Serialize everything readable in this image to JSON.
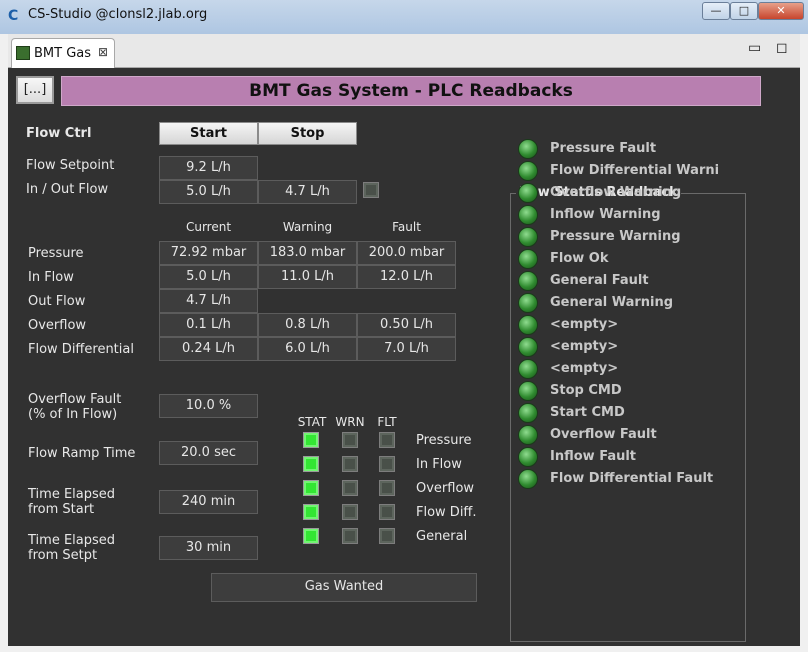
{
  "window": {
    "title": "CS-Studio @clonsl2.jlab.org",
    "min": "—",
    "max": "□",
    "close": "✕"
  },
  "tab": {
    "label": "BMT Gas",
    "close": "⊠"
  },
  "panel": {
    "minimize": "▭",
    "maximize": "◻"
  },
  "header": {
    "menu_button": "[...]",
    "title": "BMT Gas System - PLC Readbacks"
  },
  "flow_ctrl": {
    "label": "Flow Ctrl",
    "start": "Start",
    "stop": "Stop"
  },
  "flow_setpoint": {
    "label": "Flow Setpoint",
    "value": "9.2 L/h"
  },
  "in_out_flow": {
    "label": "In / Out Flow",
    "in_value": "5.0 L/h",
    "out_value": "4.7 L/h"
  },
  "table": {
    "columns": [
      "Current",
      "Warning",
      "Fault"
    ],
    "rows": [
      {
        "label": "Pressure",
        "current": "72.92 mbar",
        "warning": "183.0 mbar",
        "fault": "200.0 mbar"
      },
      {
        "label": "In Flow",
        "current": "5.0 L/h",
        "warning": "11.0 L/h",
        "fault": "12.0 L/h"
      },
      {
        "label": "Out Flow",
        "current": "4.7 L/h",
        "warning": "",
        "fault": ""
      },
      {
        "label": "Overflow",
        "current": "0.1 L/h",
        "warning": "0.8 L/h",
        "fault": "0.50 L/h"
      },
      {
        "label": "Flow Differential",
        "current": "0.24 L/h",
        "warning": "6.0 L/h",
        "fault": "7.0 L/h"
      }
    ]
  },
  "params": [
    {
      "label_line1": "Overflow Fault",
      "label_line2": "(% of In Flow)",
      "value": "10.0 %"
    },
    {
      "label_line1": "Flow Ramp Time",
      "label_line2": "",
      "value": "20.0 sec"
    },
    {
      "label_line1": "Time Elapsed",
      "label_line2": "from Start",
      "value": "240 min"
    },
    {
      "label_line1": "Time Elapsed",
      "label_line2": "from Setpt",
      "value": "30 min"
    }
  ],
  "status_matrix": {
    "headers": [
      "STAT",
      "WRN",
      "FLT"
    ],
    "rows": [
      {
        "label": "Pressure",
        "stat": true,
        "wrn": false,
        "flt": false
      },
      {
        "label": "In Flow",
        "stat": true,
        "wrn": false,
        "flt": false
      },
      {
        "label": "Overflow",
        "stat": true,
        "wrn": false,
        "flt": false
      },
      {
        "label": "Flow Diff.",
        "stat": true,
        "wrn": false,
        "flt": false
      },
      {
        "label": "General",
        "stat": true,
        "wrn": false,
        "flt": false
      }
    ]
  },
  "gas_wanted": "Gas Wanted",
  "raw_status": {
    "title": "Raw Status Readback",
    "items": [
      "Pressure Fault",
      "Flow Differential Warning",
      "Overflow Warning",
      "Inflow Warning",
      "Pressure Warning",
      "Flow Ok",
      "General Fault",
      "General Warning",
      "<empty>",
      "<empty>",
      "<empty>",
      "Stop CMD",
      "Start CMD",
      "Overflow Fault",
      "Inflow Fault",
      "Flow Differential Fault"
    ]
  },
  "colors": {
    "background": "#313131",
    "banner": "#b87fb0",
    "led_on": "#33e633",
    "led_off": "#495049"
  }
}
